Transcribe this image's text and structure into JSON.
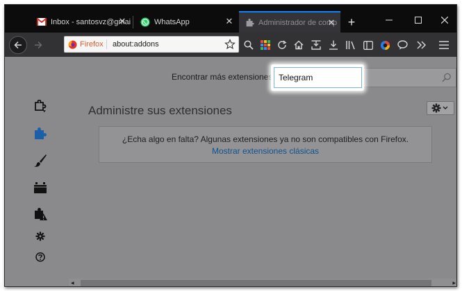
{
  "tabs": [
    {
      "label": "Inbox - santosvz@gmai",
      "icon": "gmail-icon"
    },
    {
      "label": "WhatsApp",
      "icon": "whatsapp-icon"
    },
    {
      "label": "Administrador de comp",
      "icon": "puzzle-icon",
      "active": true
    }
  ],
  "window_controls": {
    "new_tab": "+",
    "minimize": "—",
    "maximize": "☐",
    "close": "✕"
  },
  "urlbar": {
    "identity_label": "Firefox",
    "url": "about:addons"
  },
  "toolbar_icons": [
    "search-icon",
    "grid-icon",
    "reload-icon",
    "home-icon",
    "pocket-save-icon",
    "download-icon",
    "library-icon",
    "sidebar-icon",
    "colorful-extension-icon",
    "chat-icon",
    "overflow-icon",
    "menu-icon"
  ],
  "addons": {
    "find_label": "Encontrar más extensiones",
    "search_value": "Telegram",
    "heading": "Administre sus extensiones",
    "notice_text": "¿Echa algo en falta? Algunas extensiones ya no son compatibles con Firefox.",
    "notice_link": "Mostrar extensiones clásicas",
    "categories": [
      {
        "name": "recommendations-icon"
      },
      {
        "name": "extensions-icon",
        "selected": true
      },
      {
        "name": "themes-icon"
      },
      {
        "name": "plugins-icon"
      },
      {
        "name": "legacy-extensions-icon"
      },
      {
        "name": "options-icon"
      },
      {
        "name": "help-icon"
      }
    ]
  },
  "colors": {
    "accent": "#0a84ff",
    "link": "#10528c",
    "firefox_orange": "#e25b26",
    "extensions_blue": "#1a5fa8"
  }
}
